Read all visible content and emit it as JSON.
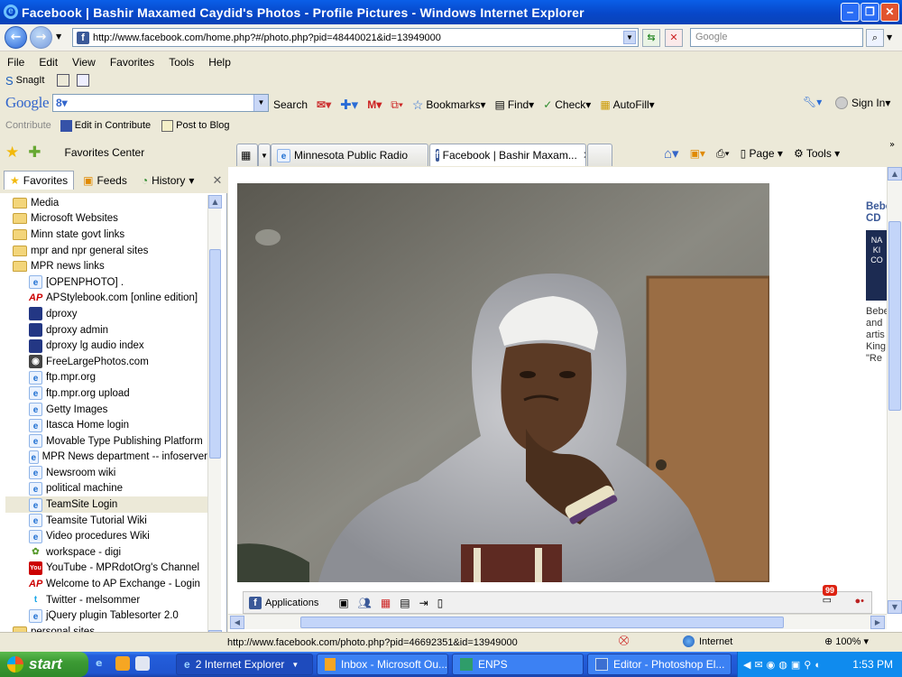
{
  "window": {
    "title": "Facebook | Bashir Maxamed Caydid's Photos - Profile Pictures - Windows Internet Explorer"
  },
  "address": {
    "url": "http://www.facebook.com/home.php?#/photo.php?pid=48440021&id=13949000",
    "search_placeholder": "Google"
  },
  "menu": [
    "File",
    "Edit",
    "View",
    "Favorites",
    "Tools",
    "Help"
  ],
  "snagit": {
    "label": "SnagIt"
  },
  "google_toolbar": {
    "logo": "Google",
    "search_label": "Search",
    "bookmarks_label": "Bookmarks",
    "find_label": "Find",
    "check_label": "Check",
    "autofill_label": "AutoFill",
    "signin_label": "Sign In"
  },
  "contribute": {
    "contribute_label": "Contribute",
    "edit_label": "Edit in Contribute",
    "post_label": "Post to Blog"
  },
  "favorites_center": {
    "label": "Favorites Center"
  },
  "tabs": [
    {
      "label": "Minnesota Public Radio"
    },
    {
      "label": "Facebook | Bashir Maxam..."
    }
  ],
  "command_bar": {
    "page_label": "Page",
    "tools_label": "Tools"
  },
  "sidebar": {
    "tabs": [
      {
        "label": "Favorites"
      },
      {
        "label": "Feeds"
      },
      {
        "label": "History"
      }
    ],
    "items": [
      {
        "label": "Media",
        "icon": "folder"
      },
      {
        "label": "Microsoft Websites",
        "icon": "folder"
      },
      {
        "label": "Minn state govt links",
        "icon": "folder"
      },
      {
        "label": "mpr and npr general sites",
        "icon": "folder"
      },
      {
        "label": "MPR news links",
        "icon": "folder"
      },
      {
        "label": "[OPENPHOTO] .",
        "icon": "ie"
      },
      {
        "label": "APStylebook.com [online edition]",
        "icon": "ap"
      },
      {
        "label": "dproxy",
        "icon": "dp"
      },
      {
        "label": "dproxy admin",
        "icon": "dp"
      },
      {
        "label": "dproxy lg audio index",
        "icon": "dp"
      },
      {
        "label": "FreeLargePhotos.com",
        "icon": "cam"
      },
      {
        "label": "ftp.mpr.org",
        "icon": "ie"
      },
      {
        "label": "ftp.mpr.org upload",
        "icon": "ie"
      },
      {
        "label": "Getty Images",
        "icon": "ie"
      },
      {
        "label": "Itasca Home login",
        "icon": "ie"
      },
      {
        "label": "Movable Type Publishing Platform",
        "icon": "ie"
      },
      {
        "label": "MPR News department -- infoserver",
        "icon": "ie"
      },
      {
        "label": "Newsroom wiki",
        "icon": "ie"
      },
      {
        "label": "political machine",
        "icon": "ie"
      },
      {
        "label": "TeamSite Login",
        "icon": "ie"
      },
      {
        "label": "Teamsite Tutorial Wiki",
        "icon": "ie"
      },
      {
        "label": "Video procedures Wiki",
        "icon": "ie"
      },
      {
        "label": "workspace - digi",
        "icon": "ws"
      },
      {
        "label": "YouTube - MPRdotOrg's Channel",
        "icon": "yt"
      },
      {
        "label": "Welcome to AP Exchange - Login",
        "icon": "ap"
      },
      {
        "label": "Twitter - melsommer",
        "icon": "tw"
      },
      {
        "label": "jQuery plugin Tablesorter 2.0",
        "icon": "ie"
      },
      {
        "label": "personal sites",
        "icon": "folder"
      }
    ]
  },
  "page": {
    "right_col_title": "Bebe CD",
    "right_col_text": [
      "Bebe",
      "and",
      "artis",
      "King",
      "\"Re"
    ],
    "fb_applications": "Applications",
    "fb_notification_count": "99"
  },
  "status": {
    "url": "http://www.facebook.com/photo.php?pid=46692351&id=13949000",
    "zone": "Internet",
    "zoom": "100%"
  },
  "taskbar": {
    "start": "start",
    "buttons": [
      {
        "label": "2 Internet Explorer"
      },
      {
        "label": "Inbox - Microsoft Ou..."
      },
      {
        "label": "ENPS"
      },
      {
        "label": "Editor - Photoshop El..."
      }
    ],
    "time": "1:53 PM"
  }
}
